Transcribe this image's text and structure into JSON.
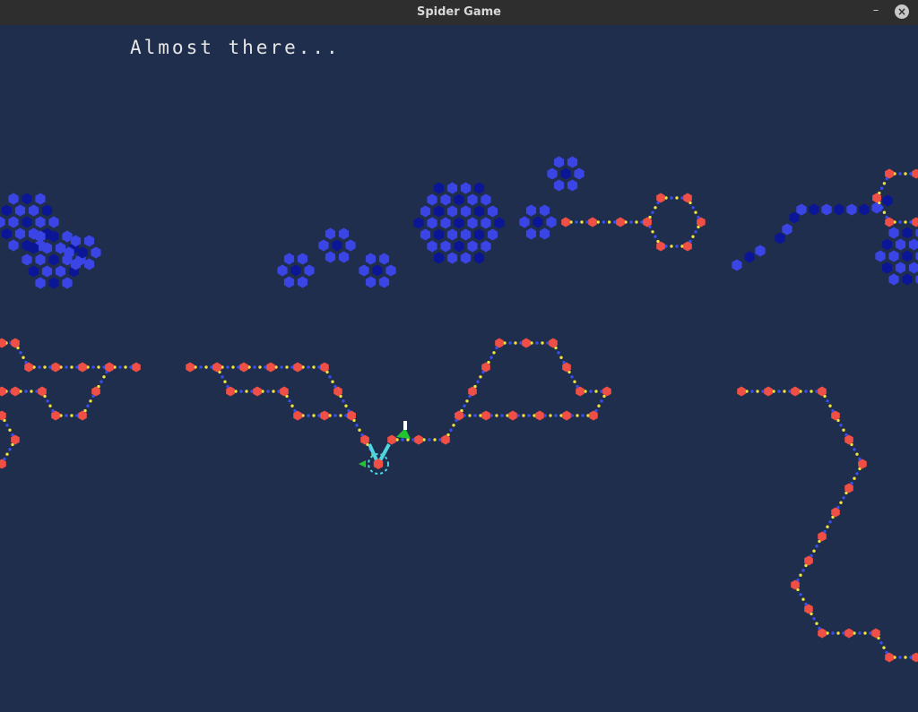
{
  "window": {
    "title": "Spider Game",
    "minimize_glyph": "–",
    "close_glyph": "×"
  },
  "game": {
    "status_text": "Almost there...",
    "colors": {
      "background": "#1f2e4c",
      "web_node": "#f04f45",
      "thread_yellow": "#f2e33b",
      "thread_blue": "#3b4ef0",
      "hex_light": "#3b45e6",
      "hex_dark": "#0b1696",
      "spider": "#4fd6e0",
      "fly": "#22c531"
    }
  }
}
